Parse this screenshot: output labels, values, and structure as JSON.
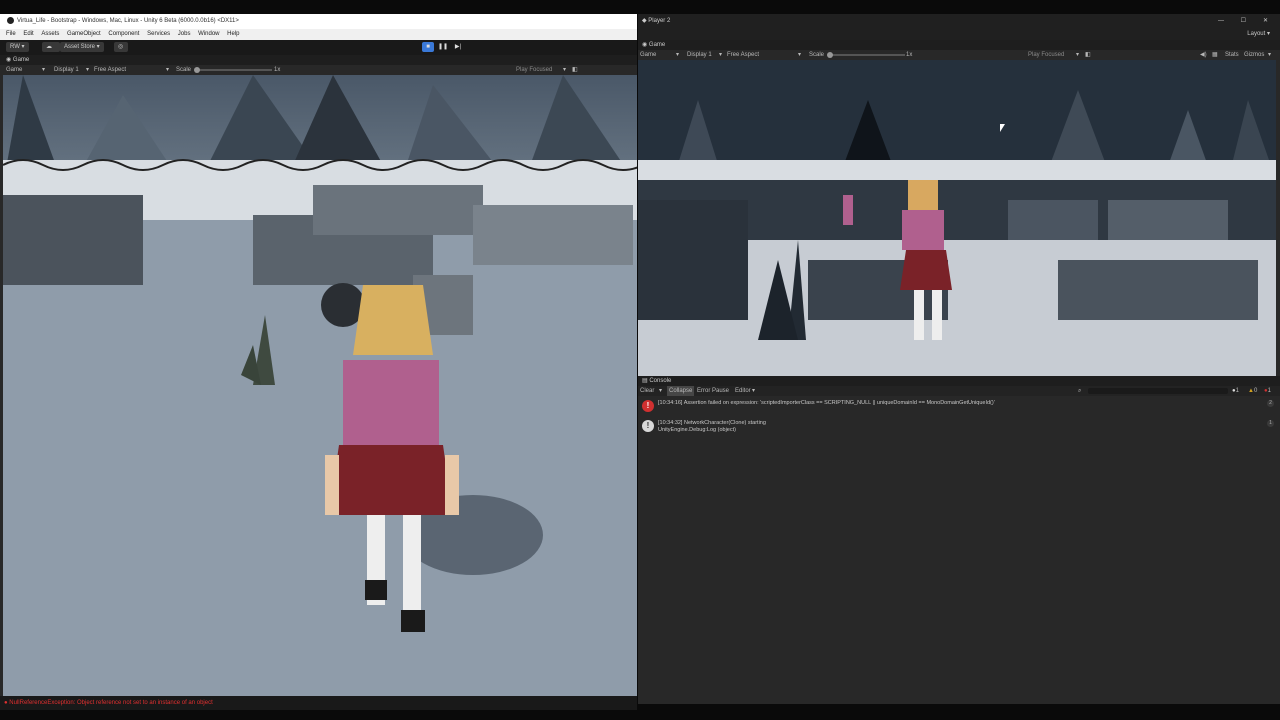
{
  "left_window": {
    "title": "Virtua_Life - Bootstrap - Windows, Mac, Linux - Unity 6 Beta (6000.0.0b16) <DX11>",
    "menu": [
      "File",
      "Edit",
      "Assets",
      "GameObject",
      "Component",
      "Services",
      "Jobs",
      "Window",
      "Help"
    ],
    "toolbar": {
      "account_label": "RW",
      "asset_store_label": "Asset Store"
    },
    "tab_label": "Game",
    "controls": {
      "game_dropdown": "Game",
      "display": "Display 1",
      "aspect": "Free Aspect",
      "scale_label": "Scale",
      "scale_value": "1x",
      "play_focused": "Play Focused"
    },
    "status_text": "NullReferenceException: Object reference not set to an instance of an object"
  },
  "right_window": {
    "title": "Player 2",
    "layout_label": "Layout",
    "tab_label": "Game",
    "controls": {
      "game_dropdown": "Game",
      "display": "Display 1",
      "aspect": "Free Aspect",
      "scale_label": "Scale",
      "scale_value": "1x",
      "play_focused": "Play Focused",
      "stats": "Stats",
      "gizmos": "Gizmos"
    },
    "console": {
      "tab_label": "Console",
      "toolbar": {
        "clear": "Clear",
        "collapse": "Collapse",
        "error_pause": "Error Pause",
        "editor": "Editor"
      },
      "counts": {
        "info": "1",
        "warn": "0",
        "error": "1"
      },
      "logs": [
        {
          "type": "error",
          "line1": "[10:34:16] Assertion failed on expression: 'scriptedImporterClass == SCRIPTING_NULL || uniqueDomainId == MonoDomainGetUniqueId()'",
          "line2": "",
          "count": "2"
        },
        {
          "type": "info",
          "line1": "[10:34:32] NetworkCharacter(Clone) starting",
          "line2": "UnityEngine.Debug:Log (object)",
          "count": "1"
        }
      ]
    }
  },
  "colors": {
    "error": "#d03030",
    "warn": "#d0a020",
    "accent": "#3a79d8"
  }
}
